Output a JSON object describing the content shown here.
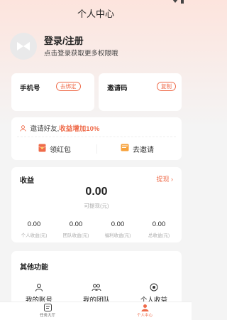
{
  "header": {
    "title": "个人中心"
  },
  "profile": {
    "login_title": "登录/注册",
    "login_subtitle": "点击登录获取更多权限哦"
  },
  "phone": {
    "label": "手机号",
    "action": "去绑定"
  },
  "invite_code": {
    "label": "邀请码",
    "action": "复制"
  },
  "promo": {
    "text_prefix": "邀请好友,",
    "text_highlight": "收益增加10%",
    "redpack_label": "领红包",
    "goinvite_label": "去邀请"
  },
  "earnings": {
    "title": "收益",
    "withdraw_label": "提现",
    "withdraw_chevron": "›",
    "total_value": "0.00",
    "total_label": "可提现(元)",
    "stats": [
      {
        "value": "0.00",
        "label": "个人收益(元)"
      },
      {
        "value": "0.00",
        "label": "团队收益(元)"
      },
      {
        "value": "0.00",
        "label": "福利收益(元)"
      },
      {
        "value": "0.00",
        "label": "总收益(元)"
      }
    ]
  },
  "functions": {
    "title": "其他功能",
    "items": [
      {
        "label": "我的账号",
        "icon": "account-icon"
      },
      {
        "label": "我的团队",
        "icon": "team-icon"
      },
      {
        "label": "个人收益",
        "icon": "income-icon"
      }
    ]
  },
  "tabbar": {
    "tabs": [
      {
        "label": "任务大厅",
        "icon": "task-hall-icon",
        "active": false
      },
      {
        "label": "个人中心",
        "icon": "profile-icon",
        "active": true
      }
    ]
  },
  "colors": {
    "accent": "#ef6b4a",
    "background": "#f4f4f4",
    "card": "#ffffff"
  }
}
